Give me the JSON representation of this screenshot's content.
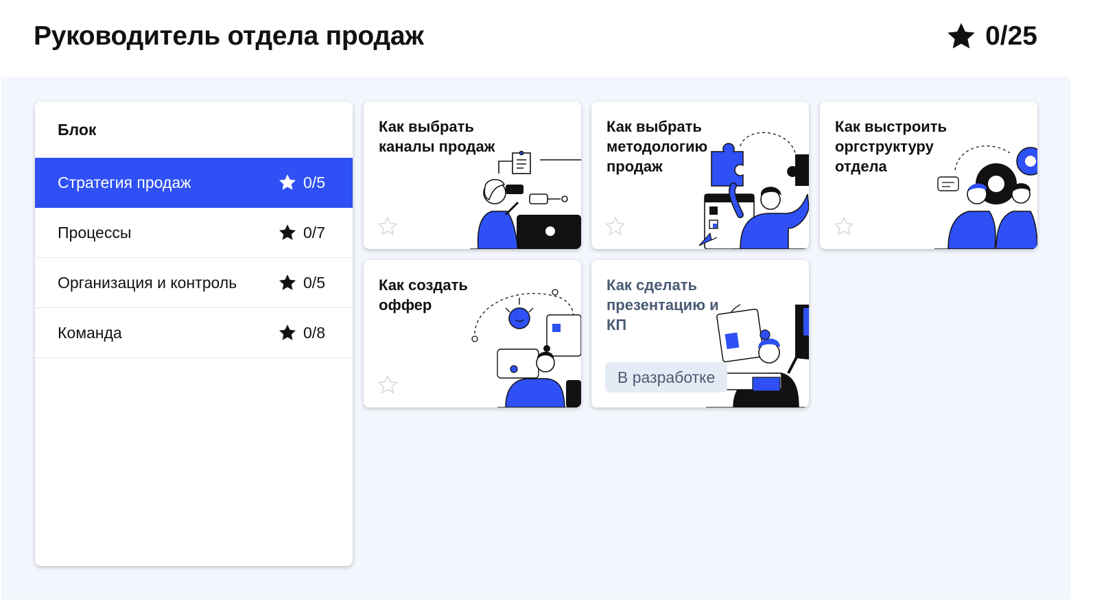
{
  "header": {
    "title": "Руководитель отдела продаж",
    "total_progress": "0/25",
    "total_icon": "star-icon"
  },
  "colors": {
    "accent": "#2e50f4",
    "background": "#f3f6fc",
    "badge_bg": "#e5ebf4",
    "muted_text": "#4a5a74"
  },
  "sidebar": {
    "heading": "Блок",
    "items": [
      {
        "label": "Стратегия продаж",
        "score": "0/5",
        "active": true
      },
      {
        "label": "Процессы",
        "score": "0/7",
        "active": false
      },
      {
        "label": "Организация и контроль",
        "score": "0/5",
        "active": false
      },
      {
        "label": "Команда",
        "score": "0/8",
        "active": false
      }
    ]
  },
  "cards": [
    {
      "title": "Как выбрать каналы продаж",
      "icon": "outline-star-icon"
    },
    {
      "title": "Как выбрать методологию продаж",
      "icon": "outline-star-icon"
    },
    {
      "title": "Как выстроить оргструктуру отдела",
      "icon": "outline-star-icon"
    },
    {
      "title": "Как создать оффер",
      "icon": "outline-star-icon"
    },
    {
      "title": "Как сделать презентацию и КП",
      "badge": "В разработке"
    }
  ]
}
